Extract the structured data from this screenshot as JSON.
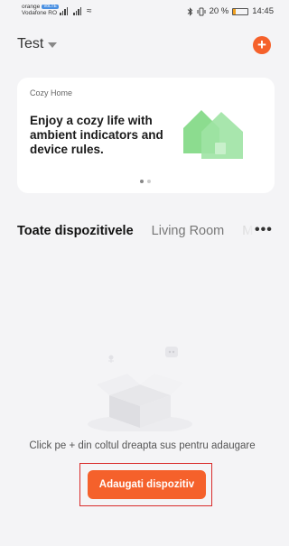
{
  "status_bar": {
    "carrier1": "orange",
    "carrier1_badge": "VoLTE",
    "carrier2": "Vodafone RO",
    "bluetooth_icon": "bluetooth-icon",
    "vibrate_icon": "vibrate-icon",
    "battery_text": "20 %",
    "battery_level": 0.2,
    "time": "14:45"
  },
  "header": {
    "home_name": "Test",
    "dropdown_icon": "chevron-down-icon",
    "add_icon": "plus-icon",
    "add_symbol": "+"
  },
  "promo": {
    "tag": "Cozy Home",
    "text": "Enjoy a cozy life with ambient indicators and device rules.",
    "image_icon": "house-icon",
    "page_count": 2,
    "active_page": 0
  },
  "tabs": {
    "items": [
      "Toate dispozitivele",
      "Living Room",
      "M"
    ],
    "active": 0,
    "more_label": "•••"
  },
  "empty_state": {
    "image_icon": "empty-box-icon",
    "hint": "Click pe + din coltul dreapta sus pentru adaugare",
    "button_label": "Adaugati dispozitiv"
  },
  "colors": {
    "accent": "#f5612b",
    "background": "#f4f4f6",
    "highlight_border": "#d92b2b",
    "promo_green": "#6fd37b"
  }
}
